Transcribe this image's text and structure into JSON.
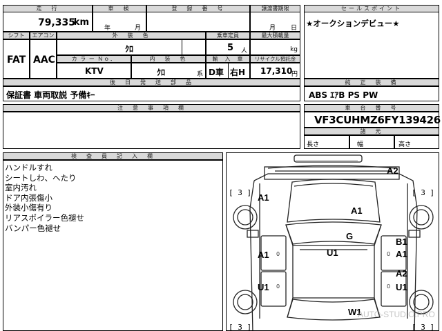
{
  "sheet": {
    "mileage_label": "走　行",
    "mileage_value": "79,335",
    "mileage_unit": "km",
    "inspection_label": "車　検",
    "inspection_year_unit": "年",
    "inspection_month_unit": "月",
    "reg_no_label": "登　録　番　号",
    "transfer_label": "譲渡書期限",
    "transfer_month_unit": "月",
    "transfer_day_unit": "日",
    "shift_label": "シフト",
    "shift_value": "FAT",
    "ac_label": "エアコン",
    "ac_value": "AAC",
    "ext_color_label": "外　装　色",
    "ext_color_value": "ｸﾛ",
    "capacity_label": "乗車定員",
    "capacity_value": "5",
    "capacity_unit": "人",
    "max_load_label": "最大積載量",
    "max_load_unit": "kg",
    "color_no_label": "カ ラ ー Ｎｏ．",
    "color_no_value": "KTV",
    "int_color_label": "内　装　色",
    "int_color_value": "ｸﾛ",
    "int_color_unit": "系",
    "import_label": "輸　入　車",
    "import_value_1": "D車",
    "import_value_2": "右H",
    "recycle_label": "リサイクル預託金",
    "recycle_value": "17,310",
    "recycle_unit": "円",
    "docs_label": "後　日　発　送　部　品",
    "docs_value": "保証書 車両取説 予備ｷｰ",
    "sales_point_label": "セールスポイント",
    "sales_point_value": "★オークションデビュー★",
    "equipment_label": "純　正　装　備",
    "equipment_value": "ABS ｴｱB PS PW",
    "caution_label": "注　意　事　項　欄",
    "chassis_label": "車　台　番　号",
    "chassis_value": "VF3CUHMZ6FY139426",
    "dims_label": "諸　元",
    "length_label": "長さ",
    "width_label": "幅",
    "height_label": "高さ",
    "inspector_label": "検　査　員　記　入　欄",
    "inspector_notes": [
      "ハンドルすれ",
      "シートしわ、へたり",
      "室内汚れ",
      "ドア内張傷小",
      "外装小傷有り",
      "リアスポイラー色褪せ",
      "バンパー色褪せ"
    ]
  },
  "diagram": {
    "marks": {
      "a2_top": "A2",
      "a1_front_left": "A1",
      "a1_hood": "A1",
      "g_windshield": "G",
      "u1_roof": "U1",
      "b1_right": "B1",
      "a1_right_front_door": "A1",
      "a1_left_front_door": "A1",
      "a2_right_rear": "A2",
      "u1_right_rear_door": "U1",
      "u1_left_rear_door": "U1",
      "w1_rear": "W1"
    },
    "tire_marks": {
      "front_left": "[ 3 ]",
      "front_right": "[ 3 ]",
      "rear_left": "[ 3 ]",
      "rear_right": "[ 3 ]"
    },
    "zero_marks": [
      "0",
      "0",
      "0",
      "0"
    ],
    "watermark": "AUTO-STUDIO.PRO"
  }
}
